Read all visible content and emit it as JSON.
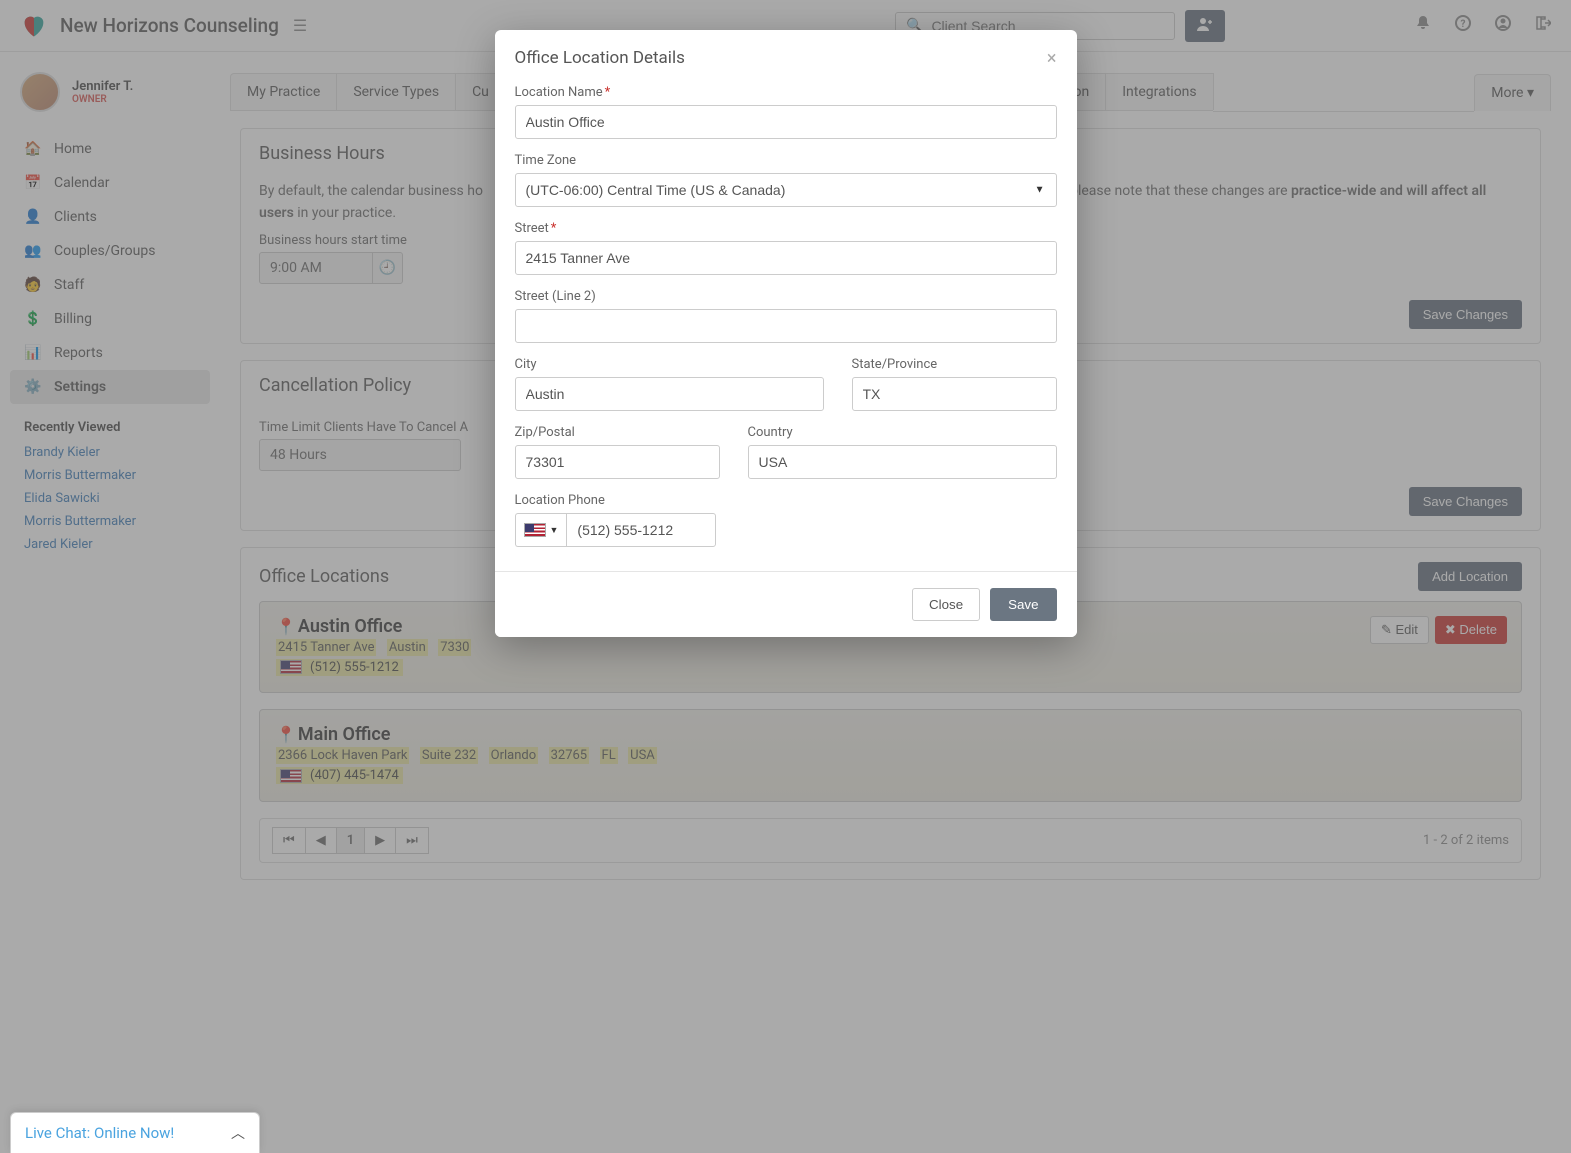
{
  "header": {
    "brand": "New Horizons Counseling",
    "search_placeholder": "Client Search"
  },
  "user": {
    "name": "Jennifer T.",
    "role": "OWNER"
  },
  "sidebar": {
    "items": [
      {
        "label": "Home",
        "icon": "home-icon"
      },
      {
        "label": "Calendar",
        "icon": "calendar-icon"
      },
      {
        "label": "Clients",
        "icon": "clients-icon"
      },
      {
        "label": "Couples/Groups",
        "icon": "groups-icon"
      },
      {
        "label": "Staff",
        "icon": "staff-icon"
      },
      {
        "label": "Billing",
        "icon": "billing-icon"
      },
      {
        "label": "Reports",
        "icon": "reports-icon"
      },
      {
        "label": "Settings",
        "icon": "settings-icon"
      }
    ],
    "recently_viewed_label": "Recently Viewed",
    "recent": [
      "Brandy Kieler",
      "Morris Buttermaker",
      "Elida Sawicki",
      "Morris Buttermaker",
      "Jared Kieler"
    ]
  },
  "tabs": [
    "My Practice",
    "Service Types",
    "Cu",
    "Subscription",
    "Integrations"
  ],
  "more_label": "More",
  "business_hours": {
    "title": "Business Hours",
    "desc_prefix": "By default, the calendar business ho",
    "desc_suffix": "wever please note that these changes are ",
    "desc_bold": "practice-wide and will affect all users",
    "desc_end": " in your practice.",
    "start_label": "Business hours start time",
    "start_value": "9:00 AM",
    "save_label": "Save Changes"
  },
  "cancellation": {
    "title": "Cancellation Policy",
    "limit_label": "Time Limit Clients Have To Cancel A",
    "limit_value": "48 Hours",
    "save_label": "Save Changes"
  },
  "office_locations": {
    "title": "Office Locations",
    "add_label": "Add Location",
    "locations": [
      {
        "name": "Austin Office",
        "street": "2415 Tanner Ave",
        "city": "Austin",
        "zip": "7330",
        "phone": "(512) 555-1212",
        "edit_label": "Edit",
        "delete_label": "Delete"
      },
      {
        "name": "Main Office",
        "street": "2366 Lock Haven Park",
        "line2": "Suite 232",
        "city": "Orlando",
        "zip": "32765",
        "state": "FL",
        "country": "USA",
        "phone": "(407) 445-1474"
      }
    ],
    "pager": {
      "current": "1",
      "info": "1 - 2 of 2 items"
    }
  },
  "modal": {
    "title": "Office Location Details",
    "fields": {
      "location_name_label": "Location Name",
      "location_name_value": "Austin Office",
      "timezone_label": "Time Zone",
      "timezone_value": "(UTC-06:00) Central Time (US & Canada)",
      "street_label": "Street",
      "street_value": "2415 Tanner Ave",
      "street2_label": "Street (Line 2)",
      "street2_value": "",
      "city_label": "City",
      "city_value": "Austin",
      "state_label": "State/Province",
      "state_value": "TX",
      "zip_label": "Zip/Postal",
      "zip_value": "73301",
      "country_label": "Country",
      "country_value": "USA",
      "phone_label": "Location Phone",
      "phone_value": "(512) 555-1212"
    },
    "close_label": "Close",
    "save_label": "Save"
  },
  "live_chat": {
    "label": "Live Chat: Online Now!"
  }
}
